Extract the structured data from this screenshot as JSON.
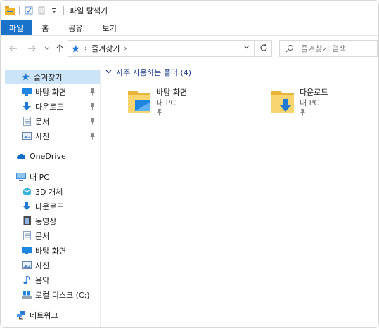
{
  "window": {
    "title": "파일 탐색기"
  },
  "ribbon": {
    "tabs": [
      "파일",
      "홈",
      "공유",
      "보기"
    ]
  },
  "address": {
    "location": "즐겨찾기"
  },
  "search": {
    "placeholder": "즐겨찾기 검색"
  },
  "sidebar": {
    "quick_access": {
      "label": "즐겨찾기",
      "items": [
        {
          "label": "바탕 화면",
          "icon": "desktop-icon",
          "pinned": true
        },
        {
          "label": "다운로드",
          "icon": "download-icon",
          "pinned": true
        },
        {
          "label": "문서",
          "icon": "document-icon",
          "pinned": true
        },
        {
          "label": "사진",
          "icon": "picture-icon",
          "pinned": true
        }
      ]
    },
    "onedrive": {
      "label": "OneDrive"
    },
    "this_pc": {
      "label": "내 PC",
      "items": [
        {
          "label": "3D 개체",
          "icon": "3d-objects-icon"
        },
        {
          "label": "다운로드",
          "icon": "download-icon"
        },
        {
          "label": "동영상",
          "icon": "video-icon"
        },
        {
          "label": "문서",
          "icon": "document-icon"
        },
        {
          "label": "바탕 화면",
          "icon": "desktop-icon"
        },
        {
          "label": "사진",
          "icon": "picture-icon"
        },
        {
          "label": "음악",
          "icon": "music-icon"
        },
        {
          "label": "로컬 디스크 (C:)",
          "icon": "drive-icon"
        }
      ]
    },
    "network": {
      "label": "네트워크"
    }
  },
  "content": {
    "group_title": "자주 사용하는 폴더 (4)",
    "folders": [
      {
        "name": "바탕 화면",
        "location": "내 PC"
      },
      {
        "name": "다운로드",
        "location": "내 PC"
      }
    ]
  },
  "colors": {
    "accent": "#1a73c9",
    "selected": "#cce4f7",
    "group_header": "#1e3d8a",
    "folder": "#f5c542"
  }
}
